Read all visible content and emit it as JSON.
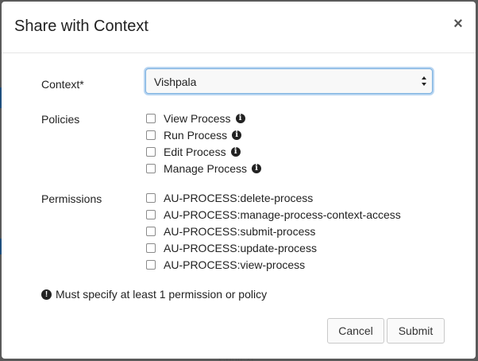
{
  "dialog": {
    "title": "Share with Context",
    "close_glyph": "×"
  },
  "context": {
    "label": "Context*",
    "selected": "Vishpala"
  },
  "policies": {
    "label": "Policies",
    "items": [
      {
        "label": "View Process",
        "checked": false,
        "info": true
      },
      {
        "label": "Run Process",
        "checked": false,
        "info": true
      },
      {
        "label": "Edit Process",
        "checked": false,
        "info": true
      },
      {
        "label": "Manage Process",
        "checked": false,
        "info": true
      }
    ]
  },
  "permissions": {
    "label": "Permissions",
    "items": [
      {
        "label": "AU-PROCESS:delete-process",
        "checked": false
      },
      {
        "label": "AU-PROCESS:manage-process-context-access",
        "checked": false
      },
      {
        "label": "AU-PROCESS:submit-process",
        "checked": false
      },
      {
        "label": "AU-PROCESS:update-process",
        "checked": false
      },
      {
        "label": "AU-PROCESS:view-process",
        "checked": false
      }
    ]
  },
  "warning": {
    "icon": "exclamation-circle-icon",
    "text": "Must specify at least 1 permission or policy"
  },
  "footer": {
    "cancel_label": "Cancel",
    "submit_label": "Submit"
  },
  "background": {
    "text": "Context"
  },
  "colors": {
    "select_focus": "#7ab0e0",
    "backdrop": "#5a5a5a"
  }
}
